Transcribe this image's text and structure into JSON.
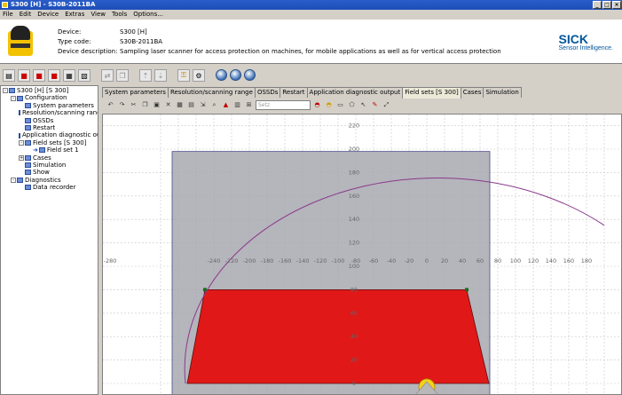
{
  "window": {
    "title": "S300 [H] - S30B-2011BA",
    "buttons": {
      "minimize": "_",
      "maximize": "□",
      "close": "×"
    }
  },
  "menu": [
    "File",
    "Edit",
    "Device",
    "Extras",
    "View",
    "Tools",
    "Options..."
  ],
  "device": {
    "device_label": "Device:",
    "device_value": "S300 [H]",
    "type_label": "Type code:",
    "type_value": "S30B-2011BA",
    "desc_label": "Device description:",
    "desc_value": "Sampling laser scanner for access protection on machines, for mobile applications as well as for vertical access protection"
  },
  "brand": {
    "logo": "SICK",
    "tagline": "Sensor Intelligence."
  },
  "tree": [
    {
      "label": "S300 [H] [S 300]",
      "level": 0,
      "expander": "-"
    },
    {
      "label": "Configuration",
      "level": 1,
      "expander": "-"
    },
    {
      "label": "System parameters",
      "level": 2
    },
    {
      "label": "Resolution/scanning rang",
      "level": 2
    },
    {
      "label": "OSSDs",
      "level": 2
    },
    {
      "label": "Restart",
      "level": 2
    },
    {
      "label": "Application diagnostic ou",
      "level": 2
    },
    {
      "label": "Field sets [S 300]",
      "level": 2,
      "expander": "-"
    },
    {
      "label": "Field set 1",
      "level": 3,
      "selected": true
    },
    {
      "label": "Cases",
      "level": 2,
      "expander": "+"
    },
    {
      "label": "Simulation",
      "level": 2
    },
    {
      "label": "Show",
      "level": 2
    },
    {
      "label": "Diagnostics",
      "level": 1,
      "expander": "-"
    },
    {
      "label": "Data recorder",
      "level": 2
    }
  ],
  "tabs": [
    {
      "label": "System parameters"
    },
    {
      "label": "Resolution/scanning range"
    },
    {
      "label": "OSSDs"
    },
    {
      "label": "Restart"
    },
    {
      "label": "Application diagnostic output"
    },
    {
      "label": "Field sets [S 300]",
      "active": true
    },
    {
      "label": "Cases"
    },
    {
      "label": "Simulation"
    }
  ],
  "zoom": {
    "placeholder": "Setz"
  },
  "canvas": {
    "x_ticks": [
      "-280",
      "-240",
      "-220",
      "-200",
      "-180",
      "-160",
      "-140",
      "-120",
      "-100",
      "-80",
      "-60",
      "-40",
      "-20",
      "0",
      "20",
      "40",
      "60",
      "80",
      "100",
      "120",
      "140",
      "160",
      "180"
    ],
    "y_ticks": [
      "220",
      "200",
      "180",
      "160",
      "140",
      "120",
      "100",
      "80",
      "60",
      "40",
      "20",
      "0"
    ],
    "colors": {
      "protective_field": "#e01818",
      "scan_range": "#a8a8b0",
      "scan_arc": "#8a3a8a",
      "grid": "#c8c8c8"
    }
  }
}
